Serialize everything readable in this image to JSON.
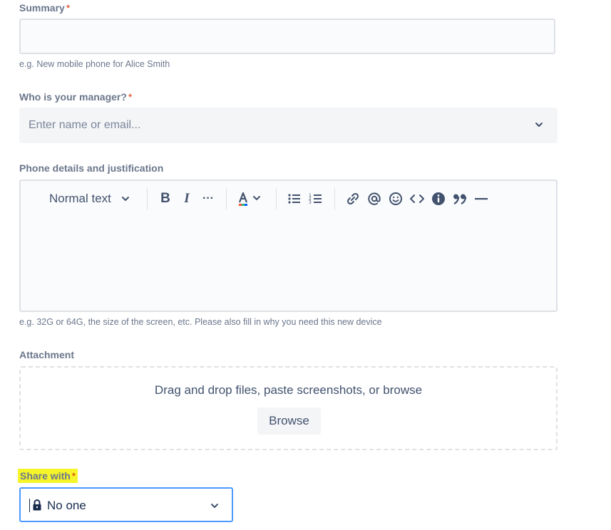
{
  "form": {
    "summary": {
      "label": "Summary",
      "required_mark": "*",
      "value": "",
      "hint": "e.g. New mobile phone for Alice Smith"
    },
    "manager": {
      "label": "Who is your manager?",
      "required_mark": "*",
      "placeholder": "Enter name or email...",
      "icon": "chevron-down-icon"
    },
    "phone_details": {
      "label": "Phone details and justification",
      "hint": "e.g. 32G or 64G, the size of the screen, etc. Please also fill in why you need this new device",
      "toolbar": {
        "text_style": "Normal text",
        "bold": "B",
        "italic": "I",
        "more": "···",
        "icons": [
          "text-color-icon",
          "bullet-list-icon",
          "numbered-list-icon",
          "link-icon",
          "mention-icon",
          "emoji-icon",
          "code-icon",
          "info-icon",
          "quote-icon",
          "divider-icon"
        ]
      }
    },
    "attachment": {
      "label": "Attachment",
      "drop_text": "Drag and drop files, paste screenshots, or browse",
      "browse_label": "Browse"
    },
    "share_with": {
      "label": "Share with",
      "required_mark": "*",
      "value": "No one",
      "icon": "lock-icon"
    }
  },
  "colors": {
    "required": "#de350b",
    "focus_border": "#4c9aff",
    "highlight": "#f5f52a"
  }
}
